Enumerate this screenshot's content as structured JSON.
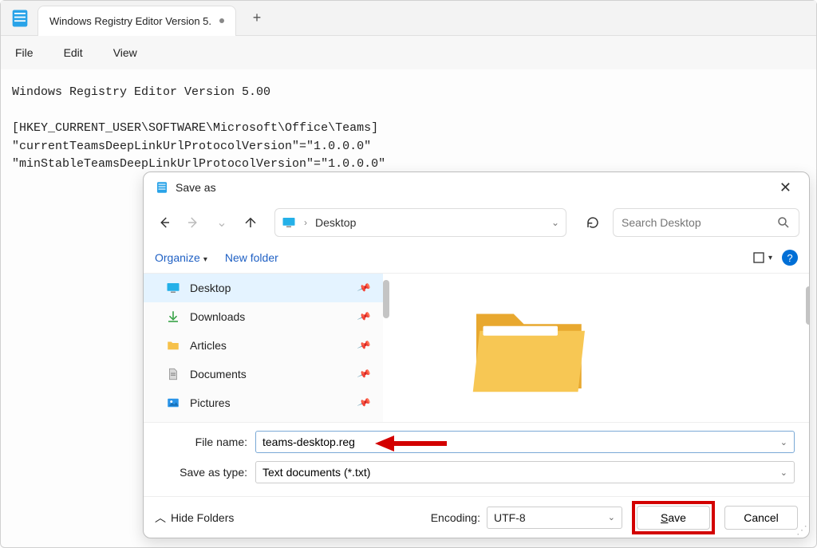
{
  "tabbar": {
    "tab_title": "Windows Registry Editor Version 5."
  },
  "menubar": {
    "file": "File",
    "edit": "Edit",
    "view": "View"
  },
  "editor": {
    "content": "Windows Registry Editor Version 5.00\n\n[HKEY_CURRENT_USER\\SOFTWARE\\Microsoft\\Office\\Teams]\n\"currentTeamsDeepLinkUrlProtocolVersion\"=\"1.0.0.0\"\n\"minStableTeamsDeepLinkUrlProtocolVersion\"=\"1.0.0.0\""
  },
  "dialog": {
    "title": "Save as",
    "breadcrumb": "Desktop",
    "search_placeholder": "Search Desktop",
    "organize": "Organize",
    "new_folder": "New folder",
    "sidebar": [
      {
        "label": "Desktop",
        "icon": "desktop"
      },
      {
        "label": "Downloads",
        "icon": "download"
      },
      {
        "label": "Articles",
        "icon": "folder"
      },
      {
        "label": "Documents",
        "icon": "document"
      },
      {
        "label": "Pictures",
        "icon": "pictures"
      }
    ],
    "filename_label": "File name:",
    "filename_value": "teams-desktop.reg",
    "savetype_label": "Save as type:",
    "savetype_value": "Text documents (*.txt)",
    "hide_folders": "Hide Folders",
    "encoding_label": "Encoding:",
    "encoding_value": "UTF-8",
    "save_button": "ave",
    "save_button_prefix": "S",
    "cancel_button": "Cancel"
  }
}
